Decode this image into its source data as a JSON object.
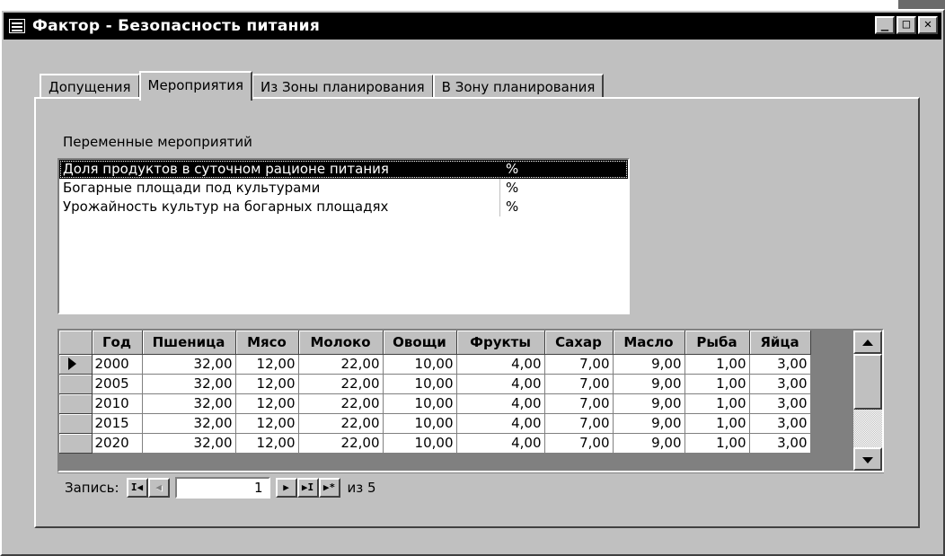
{
  "window": {
    "title": "Фактор - Безопасность питания",
    "controls": {
      "minimize": "_",
      "maximize": "□",
      "close": "✕"
    }
  },
  "tabs": [
    {
      "label": "Допущения",
      "active": false
    },
    {
      "label": "Мероприятия",
      "active": true
    },
    {
      "label": "Из Зоны планирования",
      "active": false
    },
    {
      "label": "В Зону планирования",
      "active": false
    }
  ],
  "variables": {
    "label": "Переменные мероприятий",
    "items": [
      {
        "name": "Доля продуктов в суточном рационе питания",
        "unit": "%",
        "selected": true
      },
      {
        "name": "Богарные площади под культурами",
        "unit": "%",
        "selected": false
      },
      {
        "name": "Урожайность культур на богарных площадях",
        "unit": "%",
        "selected": false
      }
    ]
  },
  "datasheet": {
    "columns": [
      "Год",
      "Пшеница",
      "Мясо",
      "Молоко",
      "Овощи",
      "Фрукты",
      "Сахар",
      "Масло",
      "Рыба",
      "Яйца"
    ],
    "rows": [
      [
        "2000",
        "32,00",
        "12,00",
        "22,00",
        "10,00",
        "4,00",
        "7,00",
        "9,00",
        "1,00",
        "3,00"
      ],
      [
        "2005",
        "32,00",
        "12,00",
        "22,00",
        "10,00",
        "4,00",
        "7,00",
        "9,00",
        "1,00",
        "3,00"
      ],
      [
        "2010",
        "32,00",
        "12,00",
        "22,00",
        "10,00",
        "4,00",
        "7,00",
        "9,00",
        "1,00",
        "3,00"
      ],
      [
        "2015",
        "32,00",
        "12,00",
        "22,00",
        "10,00",
        "4,00",
        "7,00",
        "9,00",
        "1,00",
        "3,00"
      ],
      [
        "2020",
        "32,00",
        "12,00",
        "22,00",
        "10,00",
        "4,00",
        "7,00",
        "9,00",
        "1,00",
        "3,00"
      ]
    ],
    "current_row": 0
  },
  "navigation": {
    "label": "Запись:",
    "current": "1",
    "of_text": "из 5",
    "buttons": {
      "first": "I◀",
      "prev": "◀",
      "next": "▶",
      "last": "▶I",
      "new": "▶*"
    }
  }
}
